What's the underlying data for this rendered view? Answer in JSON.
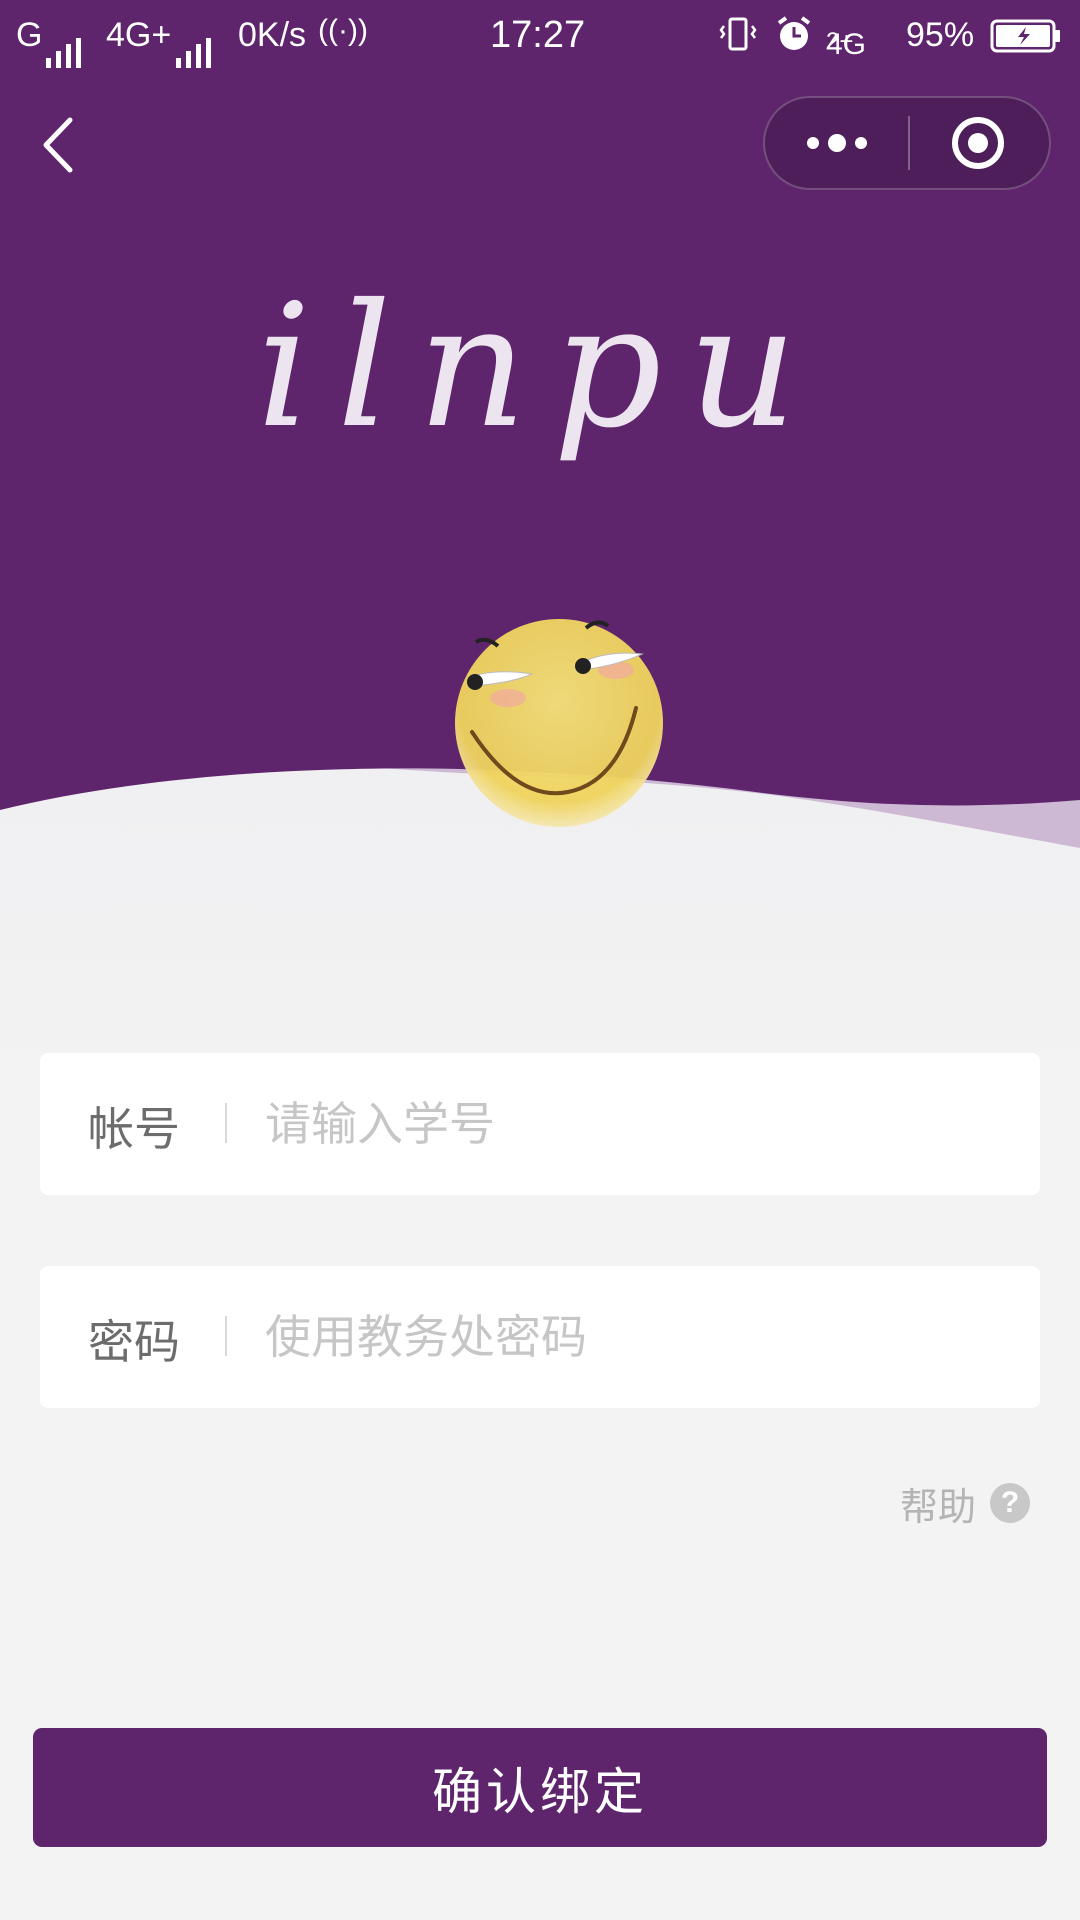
{
  "status_bar": {
    "net1": "G",
    "net2": "4G+",
    "speed": "0K/s",
    "time": "17:27",
    "net3": "4G",
    "net3_sub": "2+",
    "battery": "95%"
  },
  "nav": {
    "back_icon": "chevron-left-icon",
    "more_icon": "more-dots-icon",
    "close_icon": "target-circle-icon"
  },
  "brand": {
    "logo_text": "ilnpu"
  },
  "form": {
    "account_label": "帐号",
    "account_placeholder": "请输入学号",
    "password_label": "密码",
    "password_placeholder": "使用教务处密码",
    "help_label": "帮助",
    "help_icon_glyph": "?"
  },
  "actions": {
    "confirm_label": "确认绑定"
  },
  "colors": {
    "brand_purple": "#5e256d",
    "wave_light": "#cdb9d4",
    "background": "#f3f3f3"
  }
}
